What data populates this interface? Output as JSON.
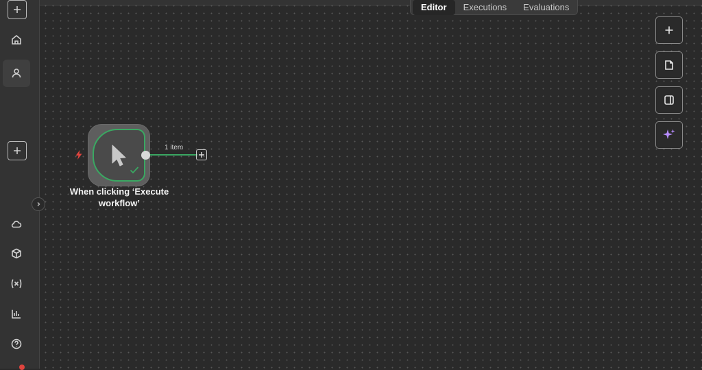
{
  "tabs": [
    {
      "label": "Editor",
      "active": true
    },
    {
      "label": "Executions",
      "active": false
    },
    {
      "label": "Evaluations",
      "active": false
    }
  ],
  "sidebar": {
    "icons": [
      "plus-icon",
      "home-icon",
      "user-icon",
      "plus-icon",
      "cloud-icon",
      "cube-icon",
      "variables-icon",
      "chart-icon",
      "help-icon"
    ]
  },
  "node": {
    "label_line1": "When clicking ‘Execute",
    "label_line2": "workflow’",
    "icon": "cursor-icon",
    "status_icon": "check-icon"
  },
  "connection": {
    "item_count": "1 item"
  },
  "right_controls": [
    "plus-icon",
    "sticky-note-icon",
    "panel-icon",
    "sparkle-icon"
  ],
  "colors": {
    "success": "#3aa862",
    "ai_accent": "#b78cff",
    "trigger": "#e0443e"
  }
}
